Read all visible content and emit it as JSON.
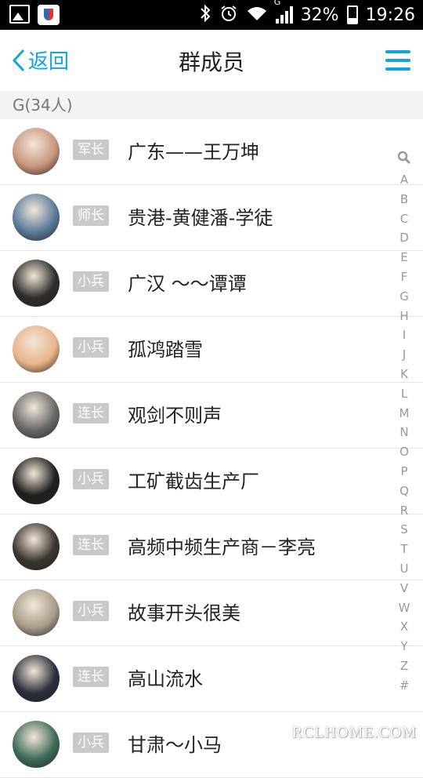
{
  "status_bar": {
    "network_type": "G",
    "battery_percent": "32%",
    "time": "19:26",
    "icons": [
      "image-icon",
      "security-shield-icon",
      "bluetooth-icon",
      "alarm-icon",
      "wifi-icon",
      "signal-icon",
      "battery-icon"
    ]
  },
  "nav": {
    "back_label": "返回",
    "title": "群成员",
    "menu_icon": "hamburger-menu-icon",
    "accent_color": "#12a4dc"
  },
  "section": {
    "header": "G(34人)"
  },
  "members": [
    {
      "role": "军长",
      "name": "广东——王万坤",
      "avatar_color": "#c9967d"
    },
    {
      "role": "师长",
      "name": "贵港-黄健潘-学徒",
      "avatar_color": "#5b7b9a"
    },
    {
      "role": "小兵",
      "name": "广汉 ～～谭谭",
      "avatar_color": "#2d2d2d"
    },
    {
      "role": "小兵",
      "name": "孤鸿踏雪",
      "avatar_color": "#e8b48a"
    },
    {
      "role": "连长",
      "name": "观剑不则声",
      "avatar_color": "#6a6a6a"
    },
    {
      "role": "小兵",
      "name": "工矿截齿生产厂",
      "avatar_color": "#1e1e1e"
    },
    {
      "role": "连长",
      "name": "高频中频生产商－李亮",
      "avatar_color": "#3a3530"
    },
    {
      "role": "小兵",
      "name": "故事开头很美",
      "avatar_color": "#a89c8a"
    },
    {
      "role": "连长",
      "name": "高山流水",
      "avatar_color": "#2b2f3a"
    },
    {
      "role": "小兵",
      "name": "甘肃～小马",
      "avatar_color": "#3f6b5a"
    }
  ],
  "index_bar": {
    "search_icon": "search-icon",
    "letters": [
      "A",
      "B",
      "C",
      "D",
      "E",
      "F",
      "G",
      "H",
      "I",
      "J",
      "K",
      "L",
      "M",
      "N",
      "O",
      "P",
      "Q",
      "R",
      "S",
      "T",
      "U",
      "V",
      "W",
      "X",
      "Y",
      "Z",
      "#"
    ]
  },
  "watermark": "RCLHOME.COM"
}
